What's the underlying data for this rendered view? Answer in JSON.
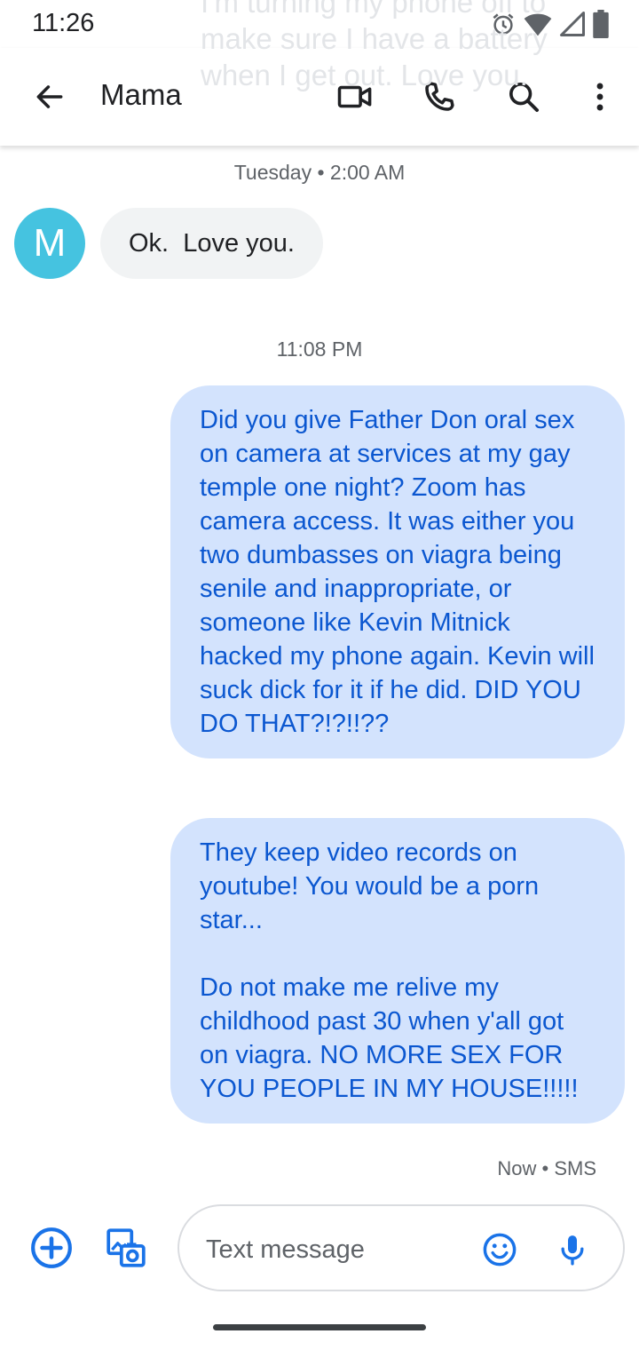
{
  "status_bar": {
    "time": "11:26",
    "icons": [
      "alarm-icon",
      "wifi-icon",
      "signal-icon",
      "battery-icon"
    ]
  },
  "ghost_preview": {
    "text": "I'm turning my phone off to make sure I have a battery when I get out. Love you."
  },
  "app_bar": {
    "title": "Mama",
    "actions": [
      "video-call-icon",
      "phone-icon",
      "search-icon",
      "more-vert-icon"
    ]
  },
  "conversation": {
    "dividers": [
      {
        "label": "Tuesday • 2:00 AM"
      },
      {
        "label": "11:08 PM"
      }
    ],
    "incoming": [
      {
        "avatar_letter": "M",
        "avatar_color": "#45c3e0",
        "text": "Ok.  Love you."
      }
    ],
    "outgoing": [
      {
        "text": "Did you give Father Don oral sex on camera at services at my gay temple one night? Zoom has camera access. It was either you two dumbasses on viagra being senile and inappropriate, or someone like Kevin Mitnick hacked my phone again. Kevin will suck dick for it if he did. DID YOU DO THAT?!?!!??"
      },
      {
        "text": "They keep video records on youtube! You would be a porn star...\n\nDo not make me relive my childhood past 30 when y'all got on viagra. NO MORE SEX FOR YOU PEOPLE IN MY HOUSE!!!!!"
      }
    ],
    "last_status": "Now • SMS"
  },
  "compose": {
    "placeholder": "Text message",
    "value": ""
  },
  "colors": {
    "accent": "#1a73e8",
    "outgoing_bubble": "#d3e3fd",
    "outgoing_text": "#0b57d0",
    "incoming_bubble": "#f1f3f4"
  }
}
